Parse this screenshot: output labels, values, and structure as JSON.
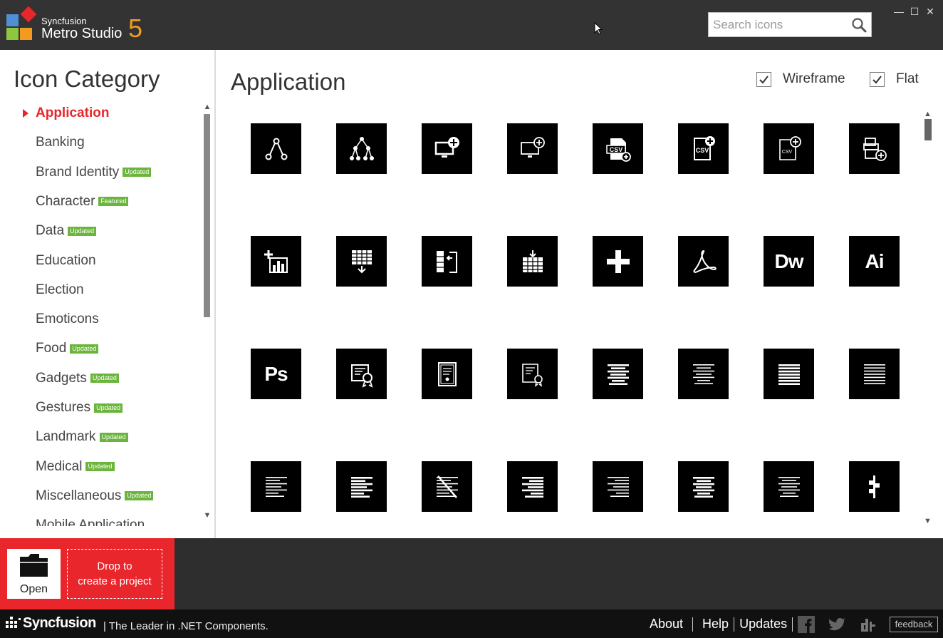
{
  "window": {
    "brand_top": "Syncfusion",
    "brand_main": "Metro Studio",
    "brand_version": "5",
    "minimize": "—",
    "maximize": "☐",
    "close": "✕"
  },
  "search": {
    "placeholder": "Search icons",
    "value": ""
  },
  "sidebar": {
    "title": "Icon Category",
    "items": [
      {
        "label": "Application",
        "badge": "",
        "active": true
      },
      {
        "label": "Banking",
        "badge": ""
      },
      {
        "label": "Brand Identity",
        "badge": "Updated"
      },
      {
        "label": "Character",
        "badge": "Featured"
      },
      {
        "label": "Data",
        "badge": "Updated"
      },
      {
        "label": "Education",
        "badge": ""
      },
      {
        "label": "Election",
        "badge": ""
      },
      {
        "label": "Emoticons",
        "badge": ""
      },
      {
        "label": "Food",
        "badge": "Updated"
      },
      {
        "label": "Gadgets",
        "badge": "Updated"
      },
      {
        "label": "Gestures",
        "badge": "Updated"
      },
      {
        "label": "Landmark",
        "badge": "Updated"
      },
      {
        "label": "Medical",
        "badge": "Updated"
      },
      {
        "label": "Miscellaneous",
        "badge": "Updated"
      },
      {
        "label": "Mobile Application",
        "badge": ""
      }
    ]
  },
  "main": {
    "title": "Application",
    "options": {
      "wireframe_label": "Wireframe",
      "wireframe_checked": true,
      "flat_label": "Flat",
      "flat_checked": true
    },
    "icons": [
      "share-nodes-icon",
      "hierarchy-icon",
      "monitor-add-icon",
      "monitor-add-outline-icon",
      "csv-add-icon",
      "csv-file-add-icon",
      "csv-file-add-outline-icon",
      "files-add-icon",
      "chart-add-icon",
      "table-download-icon",
      "column-move-icon",
      "table-insert-icon",
      "plus-icon",
      "acrobat-icon",
      "dreamweaver-icon",
      "illustrator-icon",
      "photoshop-icon",
      "certificate-icon",
      "certificate-frame-icon",
      "certificate-ribbon-icon",
      "align-center-icon",
      "align-center-outline-icon",
      "justify-icon",
      "justify-outline-icon",
      "align-left-icon",
      "align-left-bold-icon",
      "no-format-icon",
      "align-right-bold-icon",
      "align-right-icon",
      "center-bold-icon",
      "center-thin-icon",
      "vertical-align-icon"
    ],
    "text_icons": {
      "dreamweaver": "Dw",
      "illustrator": "Ai",
      "photoshop": "Ps",
      "csv": "CSV"
    }
  },
  "bottom": {
    "open_label": "Open",
    "drop_line1": "Drop to",
    "drop_line2": "create a project"
  },
  "footer": {
    "brand": "Syncfusion",
    "tagline": "| The Leader in .NET Components.",
    "links": [
      "About",
      "Help",
      "Updates"
    ],
    "feedback": "feedback"
  },
  "colors": {
    "accent_red": "#e8262c",
    "title_bar": "#333333",
    "badge_green": "#6bb53d",
    "brand_orange": "#f39b1e"
  }
}
